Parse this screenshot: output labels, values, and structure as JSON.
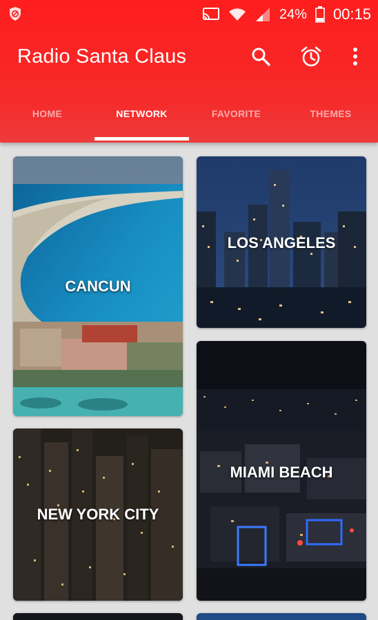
{
  "status_bar": {
    "battery_text": "24%",
    "time": "00:15",
    "icons": [
      "no-disturb-icon",
      "cast-icon",
      "wifi-icon",
      "signal-icon",
      "battery-icon"
    ]
  },
  "toolbar": {
    "title": "Radio Santa Claus",
    "icons": [
      "search-icon",
      "alarm-icon",
      "more-vert-icon"
    ]
  },
  "tabs": [
    {
      "label": "HOME",
      "active": false
    },
    {
      "label": "NETWORK",
      "active": true
    },
    {
      "label": "FAVORITE",
      "active": false
    },
    {
      "label": "THEMES",
      "active": false
    }
  ],
  "cards": [
    {
      "label": "CANCUN"
    },
    {
      "label": "LOS ANGELES"
    },
    {
      "label": "MIAMI BEACH"
    },
    {
      "label": "NEW YORK CITY"
    }
  ],
  "colors": {
    "appbar": "#f52a2a",
    "background": "#e0e0e0",
    "text_on_primary": "#ffffff"
  }
}
